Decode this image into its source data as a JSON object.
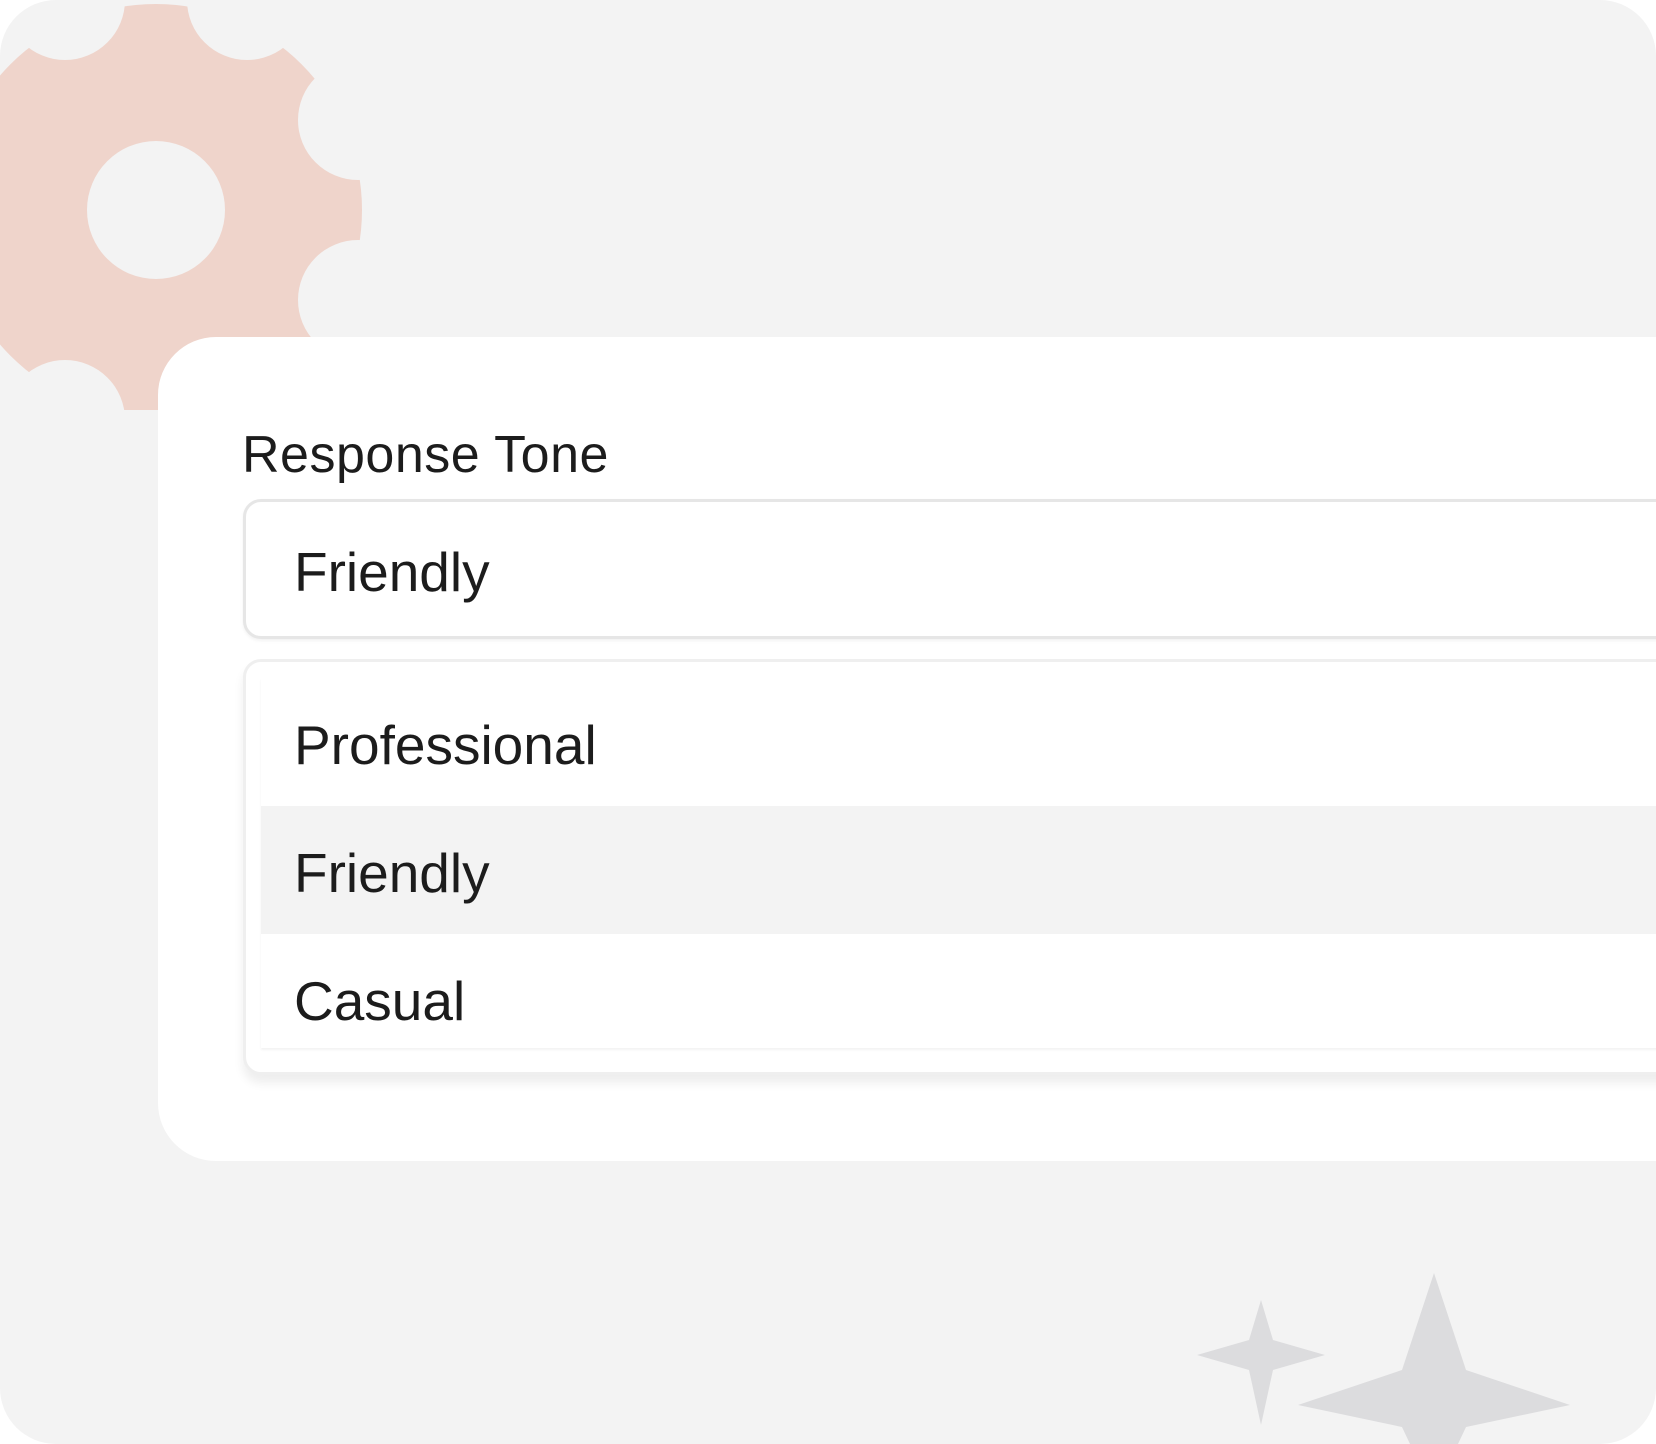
{
  "theme": {
    "background": "#f3f3f3",
    "card": "#ffffff",
    "gear_color": "#efd4cb",
    "sparkle_color": "#dcdcde",
    "highlight": "#f3f3f3",
    "text": "#1c1c1c"
  },
  "decor": {
    "gear_icon": "gear-icon",
    "sparkle_icon": "sparkle-icon"
  },
  "field": {
    "label": "Response Tone",
    "selected_value": "Friendly",
    "expanded": true
  },
  "options": [
    {
      "label": "Professional",
      "highlighted": false
    },
    {
      "label": "Friendly",
      "highlighted": true
    },
    {
      "label": "Casual",
      "highlighted": false
    }
  ]
}
